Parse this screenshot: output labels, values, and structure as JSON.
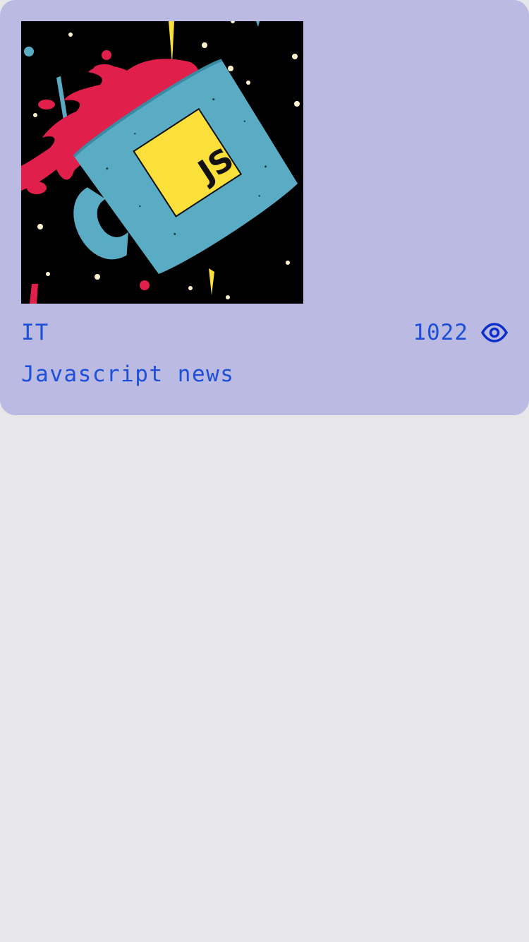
{
  "card": {
    "category": "IT",
    "view_count": "1022",
    "title": "Javascript news",
    "image": {
      "subject": "coffee mug with JS logo in space",
      "mug_badge_text": "JS"
    }
  },
  "colors": {
    "page_background": "#e7e7ea",
    "card_background": "#babae2",
    "text": "#1d4fd8",
    "eye_icon": "#0b2fc9",
    "image_background": "#000000",
    "mug": "#59acc4",
    "badge": "#fbdf3b",
    "splash": "#e01f4a"
  },
  "icons": {
    "views": "eye-icon"
  }
}
